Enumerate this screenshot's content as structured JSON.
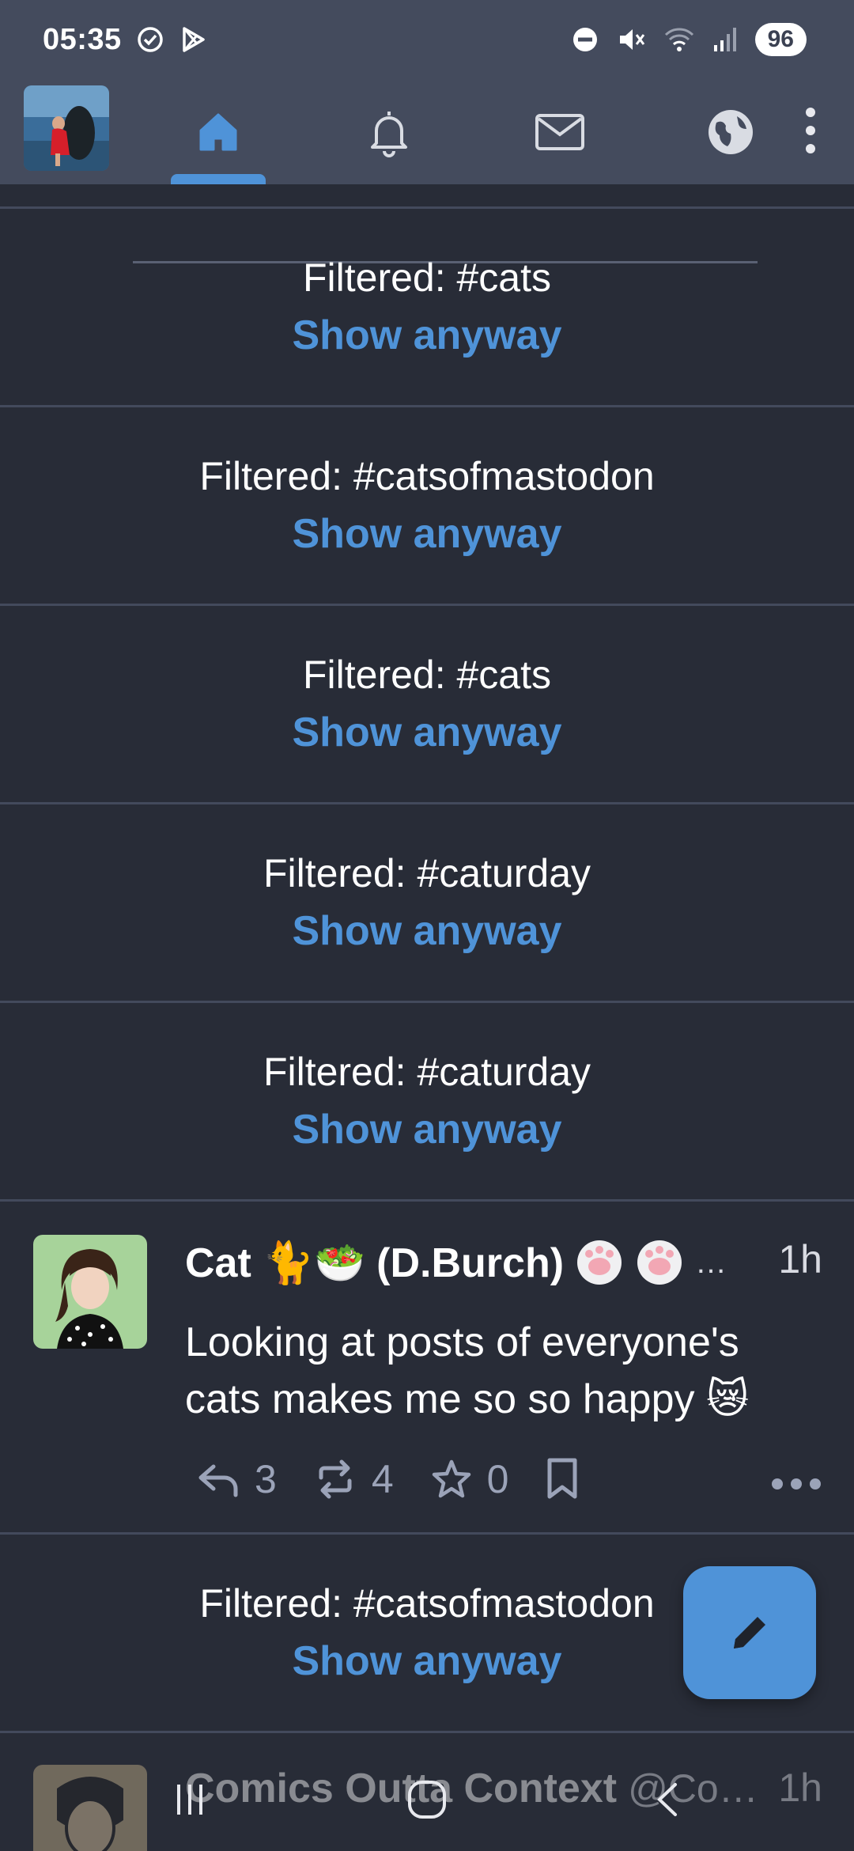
{
  "status_bar": {
    "time": "05:35",
    "battery": "96"
  },
  "app_bar": {
    "tabs": [
      "home",
      "notifications",
      "messages",
      "explore"
    ]
  },
  "feed": {
    "filtered": [
      {
        "label": "Filtered: #cats",
        "action": "Show anyway"
      },
      {
        "label": "Filtered: #catsofmastodon",
        "action": "Show anyway"
      },
      {
        "label": "Filtered: #cats",
        "action": "Show anyway"
      },
      {
        "label": "Filtered: #caturday",
        "action": "Show anyway"
      },
      {
        "label": "Filtered: #caturday",
        "action": "Show anyway"
      }
    ],
    "post": {
      "name": "Cat 🐈🥗 (D.Burch)",
      "name_extra": "…",
      "time": "1h",
      "content": "Looking at posts of everyone's cats makes me so so happy 😿",
      "replies": "3",
      "boosts": "4",
      "favourites": "0"
    },
    "filtered_after": {
      "label": "Filtered: #catsofmastodon",
      "action": "Show anyway"
    },
    "partial_post": {
      "name": "Comics Outta Context",
      "handle": "@Co…",
      "time": "1h"
    }
  },
  "colors": {
    "accent": "#4f93d8",
    "background": "#282c37",
    "bar": "#444b5d"
  }
}
